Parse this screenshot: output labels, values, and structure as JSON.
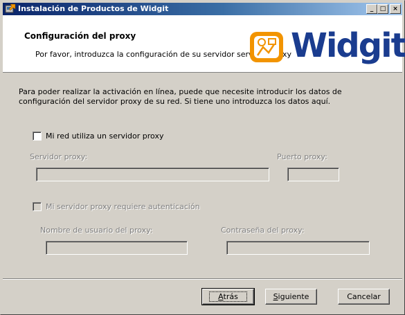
{
  "window": {
    "title": "Instalación de Productos de Widgit",
    "controls": {
      "minimize": "_",
      "maximize": "□",
      "close": "×"
    }
  },
  "header": {
    "title": "Configuración del proxy",
    "subtitle": "Por favor, introduzca la configuración de su servidor servidor proxy",
    "logo_text": "Widgit",
    "logo_colors": {
      "orange": "#f29400",
      "blue": "#1a3c8f"
    }
  },
  "body": {
    "intro_line1": "Para poder realizar la activación en línea, puede que necesite introducir los datos de",
    "intro_line2": "configuración del servidor proxy de su red. Si tiene uno introduzca los datos aquí.",
    "use_proxy_label": "Mi red utiliza un servidor proxy",
    "server_label": "Servidor proxy:",
    "server_value": "",
    "port_label": "Puerto proxy:",
    "port_value": "",
    "auth_label": "Mi servidor proxy requiere autenticación",
    "username_label": "Nombre de usuario del proxy:",
    "username_value": "",
    "password_label": "Contraseña del proxy:",
    "password_value": ""
  },
  "buttons": {
    "back": {
      "pre": "",
      "key": "A",
      "post": "trás"
    },
    "next": {
      "pre": "",
      "key": "S",
      "post": "iguiente"
    },
    "cancel": "Cancelar"
  },
  "colors": {
    "face": "#d4d0c8",
    "titlebar": "#0a246a",
    "disabled_text": "#808080"
  }
}
